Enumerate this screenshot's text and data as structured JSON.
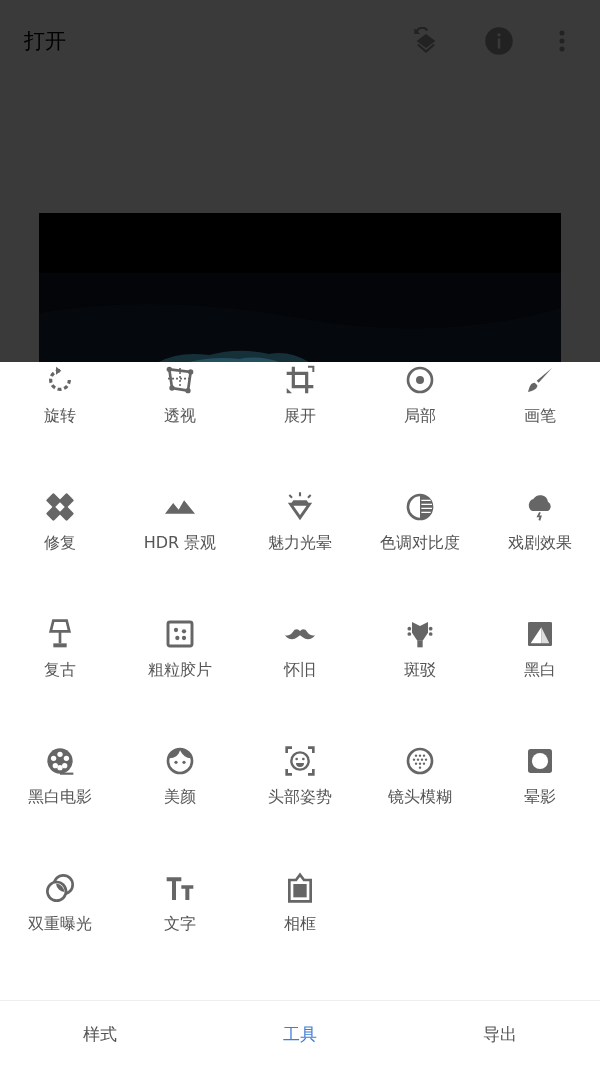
{
  "top_bar": {
    "title": "打开"
  },
  "tools": [
    {
      "label": "旋转"
    },
    {
      "label": "透视"
    },
    {
      "label": "展开"
    },
    {
      "label": "局部"
    },
    {
      "label": "画笔"
    },
    {
      "label": "修复"
    },
    {
      "label": "HDR 景观"
    },
    {
      "label": "魅力光晕"
    },
    {
      "label": "色调对比度"
    },
    {
      "label": "戏剧效果"
    },
    {
      "label": "复古"
    },
    {
      "label": "粗粒胶片"
    },
    {
      "label": "怀旧"
    },
    {
      "label": "斑驳"
    },
    {
      "label": "黑白"
    },
    {
      "label": "黑白电影"
    },
    {
      "label": "美颜"
    },
    {
      "label": "头部姿势"
    },
    {
      "label": "镜头模糊"
    },
    {
      "label": "晕影"
    },
    {
      "label": "双重曝光"
    },
    {
      "label": "文字"
    },
    {
      "label": "相框"
    }
  ],
  "bottom_tabs": [
    {
      "label": "样式",
      "selected": false
    },
    {
      "label": "工具",
      "selected": true
    },
    {
      "label": "导出",
      "selected": false
    }
  ]
}
